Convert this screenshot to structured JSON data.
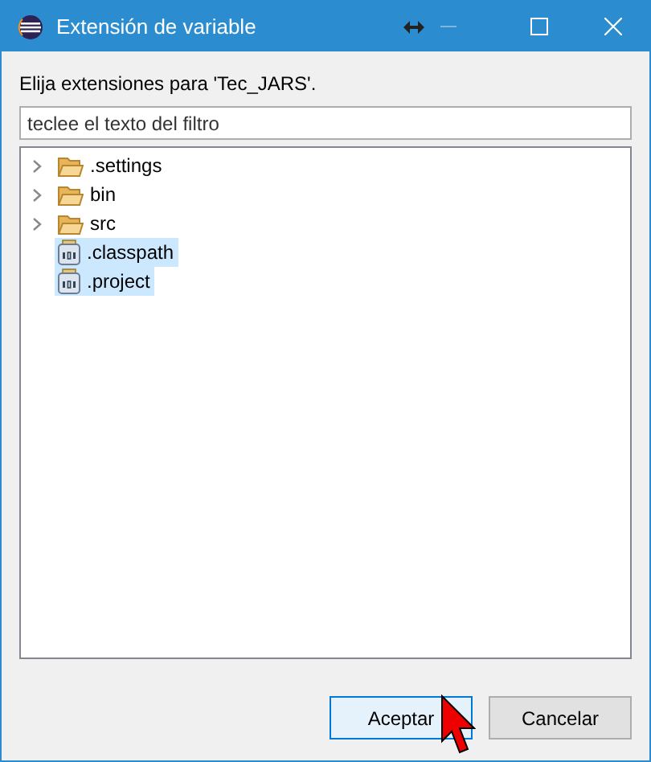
{
  "window": {
    "title": "Extensión de variable",
    "minimize_disabled": true
  },
  "prompt": "Elija extensiones para 'Tec_JARS'.",
  "filter": {
    "placeholder": "teclee el texto del filtro"
  },
  "tree": [
    {
      "kind": "folder",
      "label": ".settings",
      "selected": false
    },
    {
      "kind": "folder",
      "label": "bin",
      "selected": false
    },
    {
      "kind": "folder",
      "label": "src",
      "selected": false
    },
    {
      "kind": "file",
      "label": ".classpath",
      "selected": true
    },
    {
      "kind": "file",
      "label": ".project",
      "selected": true
    }
  ],
  "buttons": [
    {
      "label": "Aceptar",
      "default": true
    },
    {
      "label": "Cancelar",
      "default": false
    }
  ]
}
